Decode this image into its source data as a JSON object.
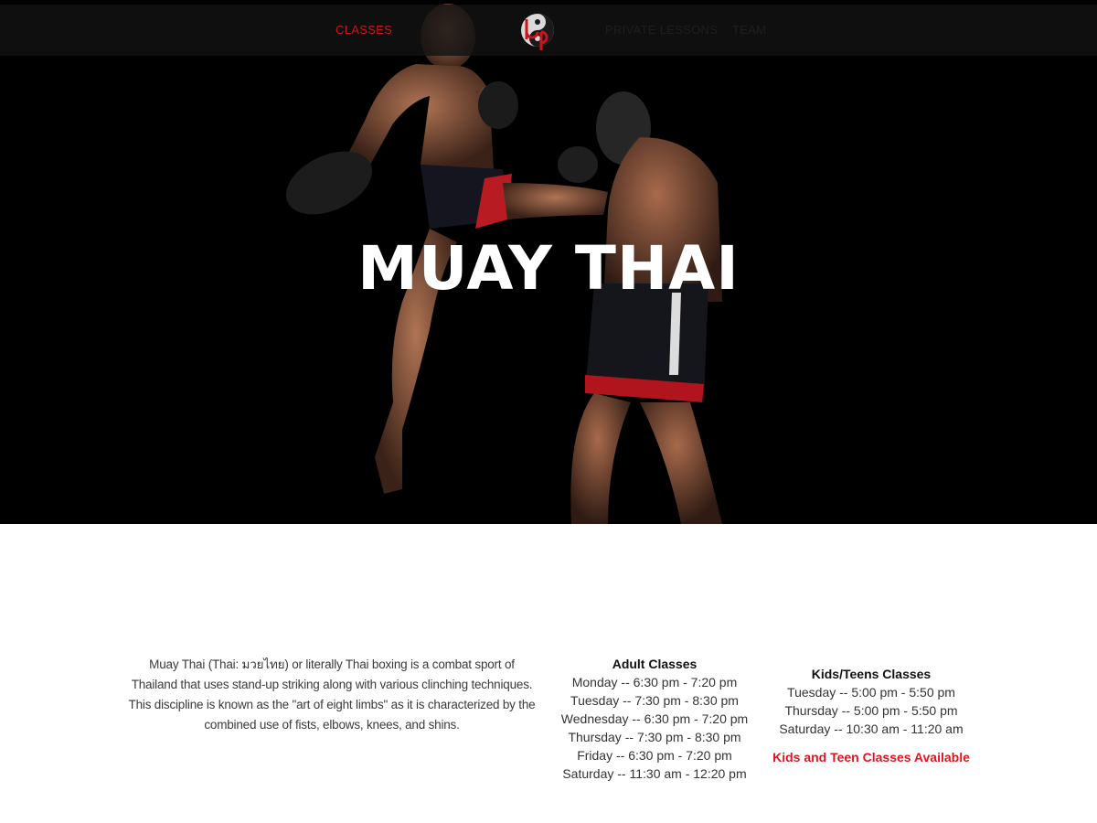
{
  "nav": {
    "items": [
      {
        "label": "CLASSES",
        "active": true
      },
      {
        "label": "PRIVATE LESSONS",
        "active": false
      },
      {
        "label": "TEAM",
        "active": false
      }
    ],
    "logo_icon": "bp-yin-yang-logo-icon"
  },
  "hero": {
    "title": "MUAY THAI",
    "image": "two-muay-thai-fighters-photo"
  },
  "description": "Muay Thai (Thai: มวยไทย) or literally Thai boxing is a combat sport of Thailand that uses stand-up striking along with various clinching techniques. This discipline is known as the \"art of eight limbs\" as it is characterized by the combined use of fists, elbows, knees, and shins.",
  "adult_classes": {
    "heading": "Adult Classes",
    "sessions": [
      "Monday -- 6:30 pm - 7:20 pm",
      "Tuesday -- 7:30 pm - 8:30 pm",
      "Wednesday -- 6:30 pm - 7:20 pm",
      "Thursday -- 7:30 pm - 8:30 pm",
      "Friday -- 6:30 pm - 7:20 pm",
      "Saturday -- 11:30 am - 12:20 pm"
    ]
  },
  "kids_classes": {
    "heading": "Kids/Teens Classes",
    "sessions": [
      "Tuesday -- 5:00 pm - 5:50 pm",
      "Thursday -- 5:00 pm - 5:50 pm",
      "Saturday -- 10:30 am - 11:20 am"
    ],
    "note": "Kids and Teen Classes Available"
  },
  "colors": {
    "accent": "#c8161d",
    "note_red": "#e0161f",
    "hero_bg": "#000000"
  }
}
